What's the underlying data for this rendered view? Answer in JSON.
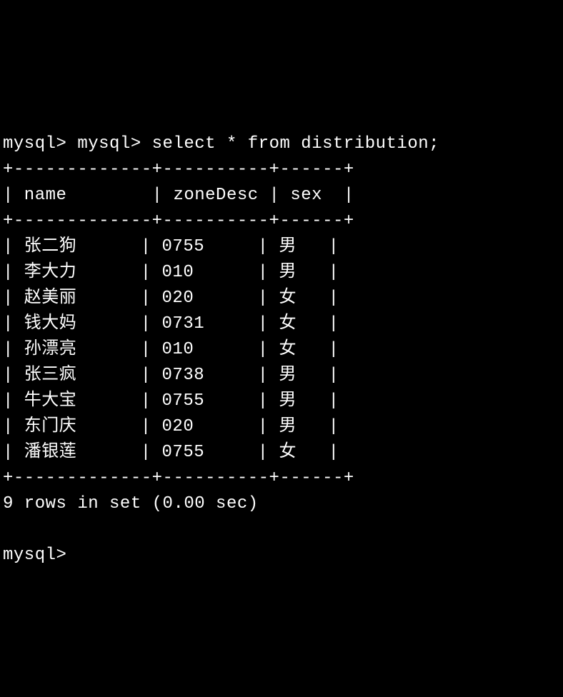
{
  "prompt1": "mysql> ",
  "prompt2": "mysql> ",
  "query": "select * from distribution;",
  "columns": [
    "name",
    "zoneDesc",
    "sex"
  ],
  "rows": [
    {
      "name": "张二狗",
      "zoneDesc": "0755",
      "sex": "男"
    },
    {
      "name": "李大力",
      "zoneDesc": "010",
      "sex": "男"
    },
    {
      "name": "赵美丽",
      "zoneDesc": "020",
      "sex": "女"
    },
    {
      "name": "钱大妈",
      "zoneDesc": "0731",
      "sex": "女"
    },
    {
      "name": "孙漂亮",
      "zoneDesc": "010",
      "sex": "女"
    },
    {
      "name": "张三疯",
      "zoneDesc": "0738",
      "sex": "男"
    },
    {
      "name": "牛大宝",
      "zoneDesc": "0755",
      "sex": "男"
    },
    {
      "name": "东门庆",
      "zoneDesc": "020",
      "sex": "男"
    },
    {
      "name": "潘银莲",
      "zoneDesc": "0755",
      "sex": "女"
    }
  ],
  "summary": "9 rows in set (0.00 sec)",
  "prompt3": "mysql> ",
  "border_top": "+-------------+----------+------+",
  "header_line": "| name        | zoneDesc | sex  |",
  "border_mid": "+-------------+----------+------+",
  "border_bot": "+-------------+----------+------+",
  "col_widths": {
    "name": 11,
    "zoneDesc": 8,
    "sex": 4
  }
}
